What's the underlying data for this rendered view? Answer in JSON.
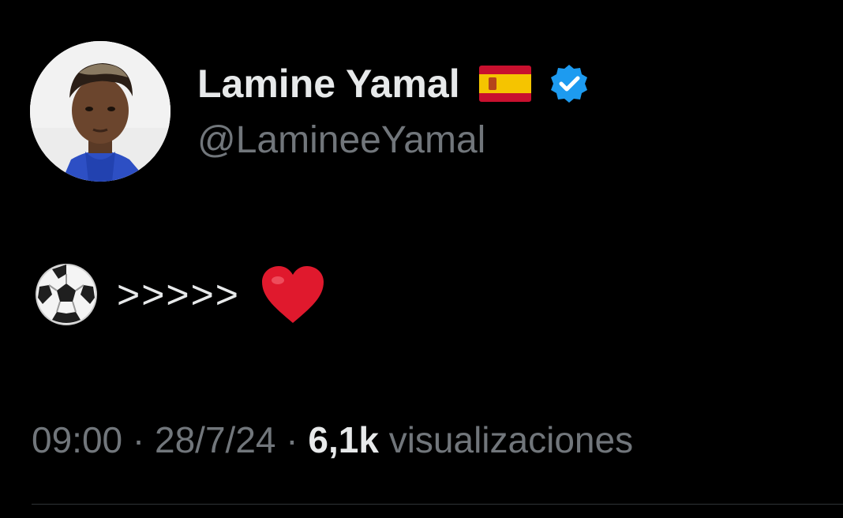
{
  "user": {
    "display_name": "Lamine Yamal",
    "flag_icon": "spain-flag-icon",
    "verified_icon": "verified-badge-icon",
    "verified_color": "#1d9bf0",
    "handle": "@LamineeYamal"
  },
  "tweet": {
    "emoji_start": "soccer-ball-emoji",
    "text": ">>>>>",
    "emoji_end": "red-heart-emoji"
  },
  "meta": {
    "time": "09:00",
    "separator": "·",
    "date": "28/7/24",
    "views_count": "6,1k",
    "views_label": "visualizaciones"
  },
  "colors": {
    "background": "#000000",
    "primary_text": "#e7e9ea",
    "secondary_text": "#71767b",
    "divider": "#2f3336"
  }
}
